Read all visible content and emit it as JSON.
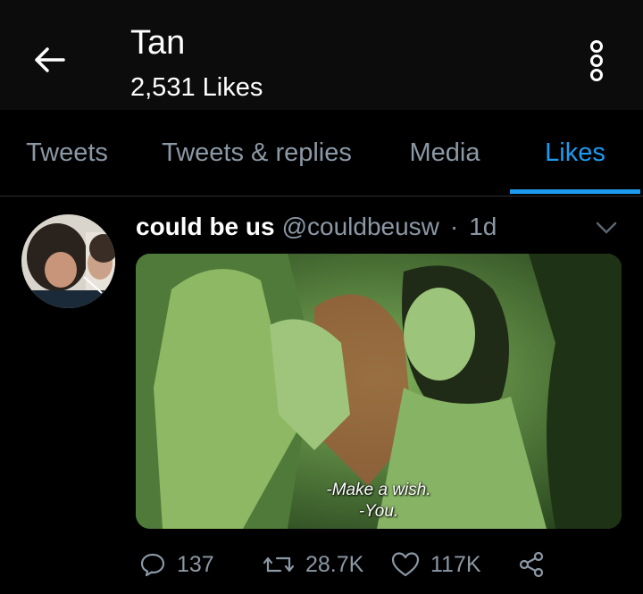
{
  "header": {
    "title": "Tan",
    "subtitle": "2,531 Likes"
  },
  "tabs": [
    {
      "label": "Tweets"
    },
    {
      "label": "Tweets & replies"
    },
    {
      "label": "Media"
    },
    {
      "label": "Likes",
      "active": true
    }
  ],
  "tweet": {
    "name": "could be us",
    "handle": "@couldbeusw",
    "separator": "·",
    "time": "1d",
    "media": {
      "subtitle_line1": "-Make a wish.",
      "subtitle_line2": "-You."
    },
    "actions": {
      "replies": "137",
      "retweets": "28.7K",
      "likes": "117K"
    }
  },
  "colors": {
    "background": "#000000",
    "header_bg": "#0c0c0d",
    "accent": "#1d9bf0",
    "muted": "#8b98a5",
    "media_tint": "#3d6a2f"
  },
  "icons": [
    "back-arrow-icon",
    "more-vertical-icon",
    "chevron-down-icon",
    "reply-icon",
    "retweet-icon",
    "like-icon",
    "share-icon"
  ]
}
